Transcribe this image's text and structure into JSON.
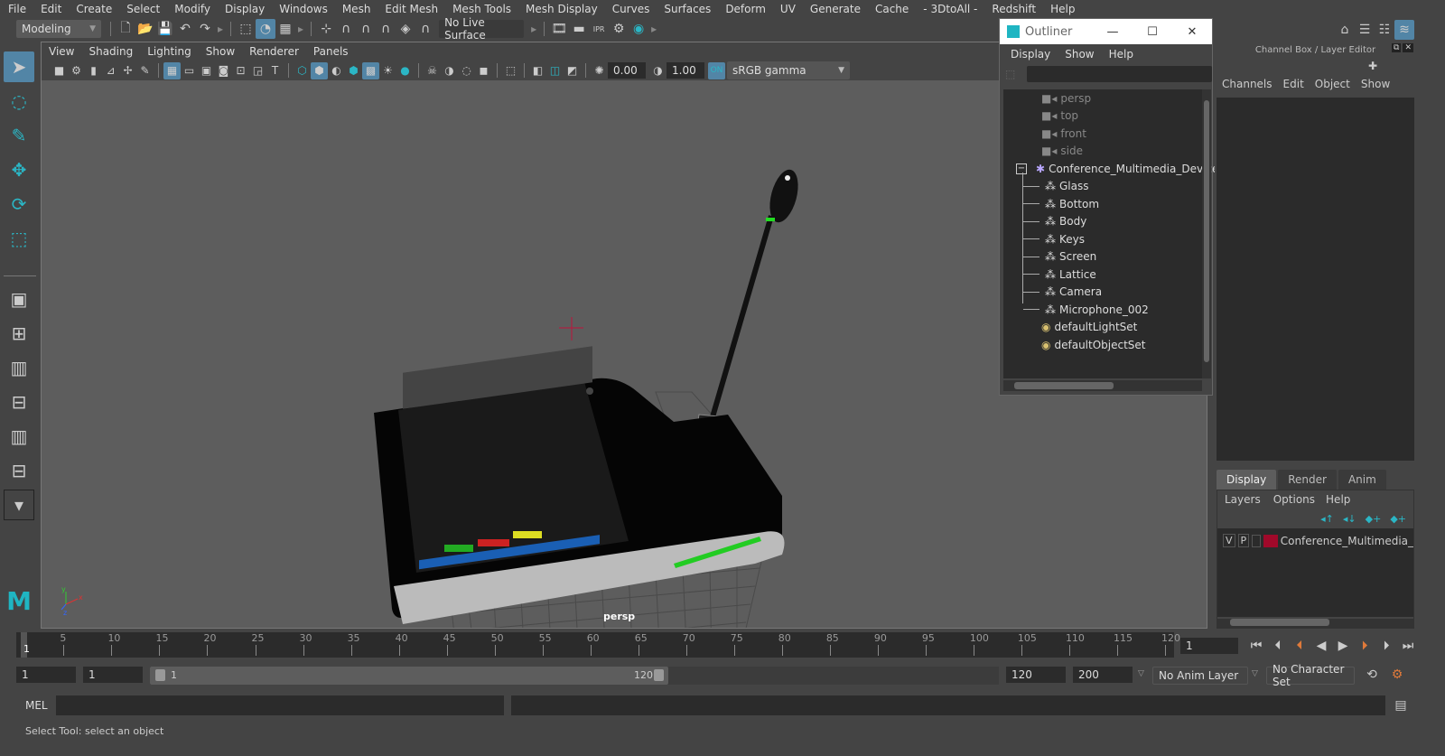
{
  "main_menu": [
    "File",
    "Edit",
    "Create",
    "Select",
    "Modify",
    "Display",
    "Windows",
    "Mesh",
    "Edit Mesh",
    "Mesh Tools",
    "Mesh Display",
    "Curves",
    "Surfaces",
    "Deform",
    "UV",
    "Generate",
    "Cache",
    "- 3DtoAll -",
    "Redshift",
    "Help"
  ],
  "shelf": {
    "mode_select": "Modeling",
    "live_surface": "No Live Surface"
  },
  "viewport": {
    "menu": [
      "View",
      "Shading",
      "Lighting",
      "Show",
      "Renderer",
      "Panels"
    ],
    "exposure": "0.00",
    "gamma": "1.00",
    "color_space": "sRGB gamma",
    "camera_label": "persp",
    "colors": {
      "background": "#5d5d5d",
      "pivot": "#c0143c"
    }
  },
  "outliner": {
    "title": "Outliner",
    "menu": [
      "Display",
      "Show",
      "Help"
    ],
    "search_value": "",
    "cameras": [
      "persp",
      "top",
      "front",
      "side"
    ],
    "group": "Conference_Multimedia_Device",
    "children": [
      "Glass",
      "Bottom",
      "Body",
      "Keys",
      "Screen",
      "Lattice",
      "Camera",
      "Microphone_002"
    ],
    "sets": [
      "defaultLightSet",
      "defaultObjectSet"
    ]
  },
  "channel_box": {
    "title": "Channel Box / Layer Editor",
    "menu": [
      "Channels",
      "Edit",
      "Object",
      "Show"
    ],
    "tabs": [
      "Display",
      "Render",
      "Anim"
    ],
    "active_tab": "Display",
    "layer_menu": [
      "Layers",
      "Options",
      "Help"
    ],
    "layers": [
      {
        "v": "V",
        "p": "P",
        "color": "#a0092a",
        "name": "Conference_Multimedia_Device"
      }
    ]
  },
  "timeline": {
    "ticks": [
      5,
      10,
      15,
      20,
      25,
      30,
      35,
      40,
      45,
      50,
      55,
      60,
      65,
      70,
      75,
      80,
      85,
      90,
      95,
      100,
      105,
      110,
      115,
      120
    ],
    "start": 1,
    "end": 120,
    "current_frame": "1",
    "current_marker": "1"
  },
  "range": {
    "start_field": "1",
    "playback_start": "1",
    "slider_start": "1",
    "slider_end": "120",
    "playback_end": "120",
    "end_field": "200",
    "anim_layer": "No Anim Layer",
    "character_set": "No Character Set"
  },
  "command_line": {
    "label": "MEL",
    "value": ""
  },
  "status_line": "Select Tool: select an object"
}
